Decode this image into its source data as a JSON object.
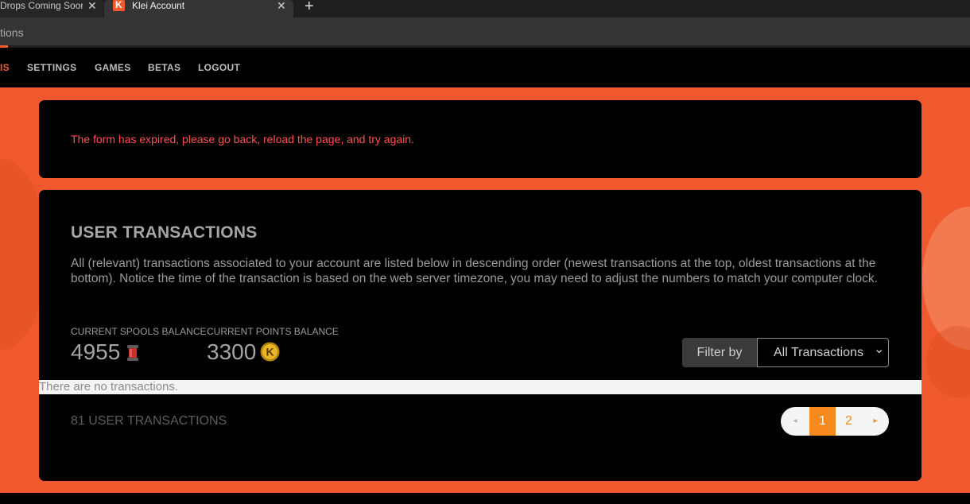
{
  "browser": {
    "tabs": [
      {
        "title": "Drops Coming Soon",
        "close": "✕"
      },
      {
        "title": "Klei Account",
        "favicon_letter": "K",
        "close": "✕"
      }
    ],
    "new_tab": "+",
    "url_fragment": "tions"
  },
  "nav": {
    "active_fragment": "IS",
    "items": [
      "SETTINGS",
      "GAMES",
      "BETAS",
      "LOGOUT"
    ]
  },
  "alert": {
    "message": "The form has expired, please go back, reload the page, and try again."
  },
  "transactions": {
    "title": "USER TRANSACTIONS",
    "description": "All (relevant) transactions associated to your account are listed below in descending order (newest transactions at the top, oldest transactions at the bottom). Notice the time of the transaction is based on the web server timezone, you may need to adjust the numbers to match your computer clock.",
    "spools_label": "CURRENT SPOOLS BALANCE",
    "spools_value": "4955",
    "points_label": "CURRENT POINTS BALANCE",
    "points_value": "3300",
    "filter_label": "Filter by",
    "filter_value": "All Transactions",
    "empty_message": "There are no transactions.",
    "count_text": "81 USER TRANSACTIONS"
  },
  "pagination": {
    "prev": "◂",
    "pages": [
      "1",
      "2"
    ],
    "current": "1",
    "next": "▸"
  },
  "colors": {
    "brand_orange": "#f0592d",
    "alert_red": "#ff4f4f",
    "active_page": "#f78a1e"
  },
  "icons": [
    "close-icon",
    "plus-icon",
    "klei-logo-icon",
    "spool-icon",
    "klei-coin-icon",
    "chevron-down-icon",
    "arrow-left-icon",
    "arrow-right-icon"
  ]
}
